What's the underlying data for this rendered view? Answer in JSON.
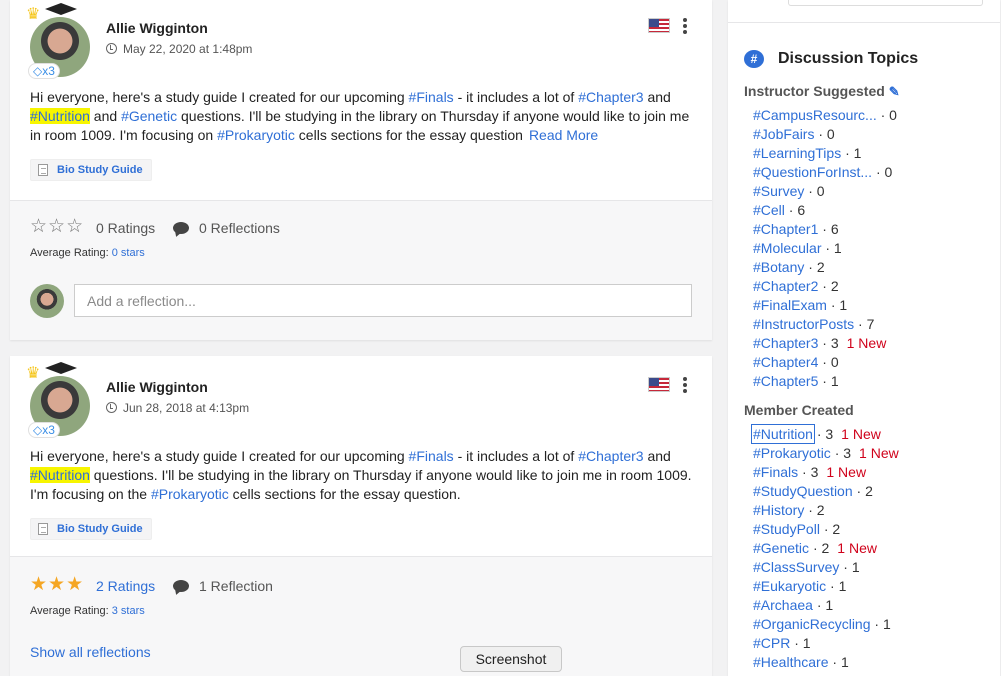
{
  "posts": [
    {
      "author": "Allie Wigginton",
      "date": "May 22, 2020 at 1:48pm",
      "badge": "x3",
      "text_segments": [
        {
          "t": "Hi everyone, here's a study guide I created for our upcoming ",
          "type": "text"
        },
        {
          "t": "#Finals",
          "type": "tag"
        },
        {
          "t": " - it includes a lot of ",
          "type": "text"
        },
        {
          "t": "#Chapter3",
          "type": "tag"
        },
        {
          "t": " and ",
          "type": "text"
        },
        {
          "t": "#Nutrition",
          "type": "highlight"
        },
        {
          "t": " and ",
          "type": "text"
        },
        {
          "t": "#Genetic",
          "type": "tag"
        },
        {
          "t": " questions. I'll be studying in the library on Thursday if anyone would like to join me in room 1009. I'm focusing on ",
          "type": "text"
        },
        {
          "t": "#Prokaryotic",
          "type": "tag"
        },
        {
          "t": " cells sections for the essay question",
          "type": "text"
        }
      ],
      "read_more": "Read More",
      "attachment": "Bio Study Guide",
      "ratings_count_label": "0 Ratings",
      "reflections_label": "0 Reflections",
      "avg_rating_label": "Average Rating:",
      "avg_rating_value": "0 stars",
      "stars_filled": 0,
      "reflection_placeholder": "Add a reflection..."
    },
    {
      "author": "Allie Wigginton",
      "date": "Jun 28, 2018 at 4:13pm",
      "badge": "x3",
      "text_segments": [
        {
          "t": "Hi everyone, here's a study guide I created for our upcoming ",
          "type": "text"
        },
        {
          "t": "#Finals",
          "type": "tag"
        },
        {
          "t": " - it includes a lot of ",
          "type": "text"
        },
        {
          "t": "#Chapter3",
          "type": "tag"
        },
        {
          "t": " and ",
          "type": "text"
        },
        {
          "t": "#Nutrition",
          "type": "highlight"
        },
        {
          "t": " questions. I'll be studying in the library on Thursday if anyone would like to join me in room 1009. I'm focusing on the ",
          "type": "text"
        },
        {
          "t": "#Prokaryotic",
          "type": "tag"
        },
        {
          "t": " cells sections for the essay question.",
          "type": "text"
        }
      ],
      "attachment": "Bio Study Guide",
      "ratings_count_label": "2 Ratings",
      "reflections_label": "1 Reflection",
      "avg_rating_label": "Average Rating:",
      "avg_rating_value": "3 stars",
      "stars_filled": 3,
      "show_all": "Show all reflections"
    }
  ],
  "tooltip": "Screenshot",
  "sidebar": {
    "title": "Discussion Topics",
    "icon": "hashtag-bubble-icon",
    "instructor_label": "Instructor Suggested",
    "member_label": "Member Created",
    "instructor_topics": [
      {
        "name": "#CampusResourc...",
        "count": "· 0",
        "new": ""
      },
      {
        "name": "#JobFairs",
        "count": "· 0",
        "new": ""
      },
      {
        "name": "#LearningTips",
        "count": "· 1",
        "new": ""
      },
      {
        "name": "#QuestionForInst...",
        "count": "· 0",
        "new": ""
      },
      {
        "name": "#Survey",
        "count": "· 0",
        "new": ""
      },
      {
        "name": "#Cell",
        "count": "· 6",
        "new": ""
      },
      {
        "name": "#Chapter1",
        "count": "· 6",
        "new": ""
      },
      {
        "name": "#Molecular",
        "count": "· 1",
        "new": ""
      },
      {
        "name": "#Botany",
        "count": "· 2",
        "new": ""
      },
      {
        "name": "#Chapter2",
        "count": "· 2",
        "new": ""
      },
      {
        "name": "#FinalExam",
        "count": "· 1",
        "new": ""
      },
      {
        "name": "#InstructorPosts",
        "count": "· 7",
        "new": ""
      },
      {
        "name": "#Chapter3",
        "count": "· 3",
        "new": "1 New"
      },
      {
        "name": "#Chapter4",
        "count": "· 0",
        "new": ""
      },
      {
        "name": "#Chapter5",
        "count": "· 1",
        "new": ""
      }
    ],
    "member_topics": [
      {
        "name": "#Nutrition",
        "count": "· 3",
        "new": "1 New"
      },
      {
        "name": "#Prokaryotic",
        "count": "· 3",
        "new": "1 New"
      },
      {
        "name": "#Finals",
        "count": "· 3",
        "new": "1 New"
      },
      {
        "name": "#StudyQuestion",
        "count": "· 2",
        "new": ""
      },
      {
        "name": "#History",
        "count": "· 2",
        "new": ""
      },
      {
        "name": "#StudyPoll",
        "count": "· 2",
        "new": ""
      },
      {
        "name": "#Genetic",
        "count": "· 2",
        "new": "1 New"
      },
      {
        "name": "#ClassSurvey",
        "count": "· 1",
        "new": ""
      },
      {
        "name": "#Eukaryotic",
        "count": "· 1",
        "new": ""
      },
      {
        "name": "#Archaea",
        "count": "· 1",
        "new": ""
      },
      {
        "name": "#OrganicRecycling",
        "count": "· 1",
        "new": ""
      },
      {
        "name": "#CPR",
        "count": "· 1",
        "new": ""
      },
      {
        "name": "#Healthcare",
        "count": "· 1",
        "new": ""
      }
    ]
  },
  "colors": {
    "link": "#2f6fd6",
    "new": "#d0021b",
    "star": "#f5a623",
    "highlight": "#f7f500"
  }
}
